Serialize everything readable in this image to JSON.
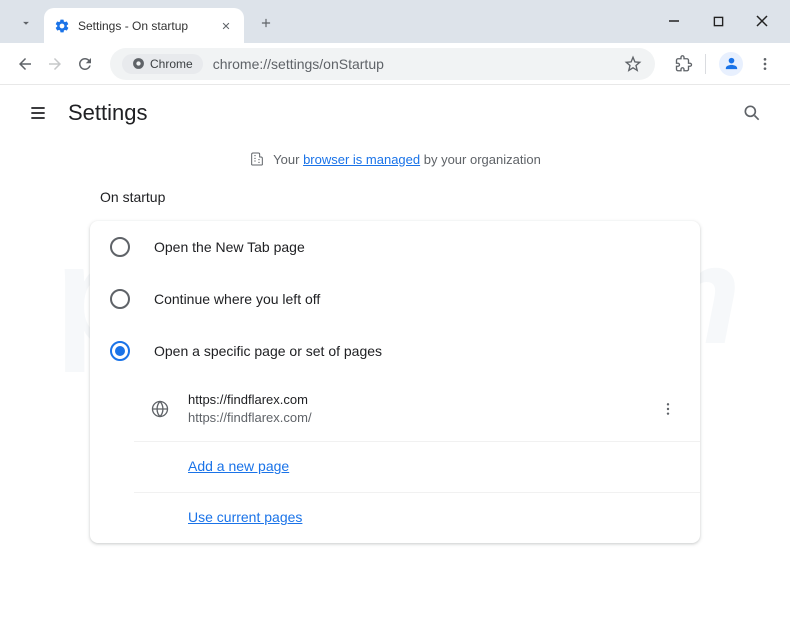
{
  "browser": {
    "tab_title": "Settings - On startup",
    "omnibox_chip": "Chrome",
    "url": "chrome://settings/onStartup"
  },
  "header": {
    "title": "Settings"
  },
  "managed": {
    "prefix": "Your ",
    "link": "browser is managed",
    "suffix": " by your organization"
  },
  "startup": {
    "section_title": "On startup",
    "options": {
      "newtab": "Open the New Tab page",
      "continue": "Continue where you left off",
      "specific": "Open a specific page or set of pages"
    },
    "page": {
      "title": "https://findflarex.com",
      "url": "https://findflarex.com/"
    },
    "add_page": "Add a new page",
    "use_current": "Use current pages"
  },
  "watermark": "pcrisk.com"
}
